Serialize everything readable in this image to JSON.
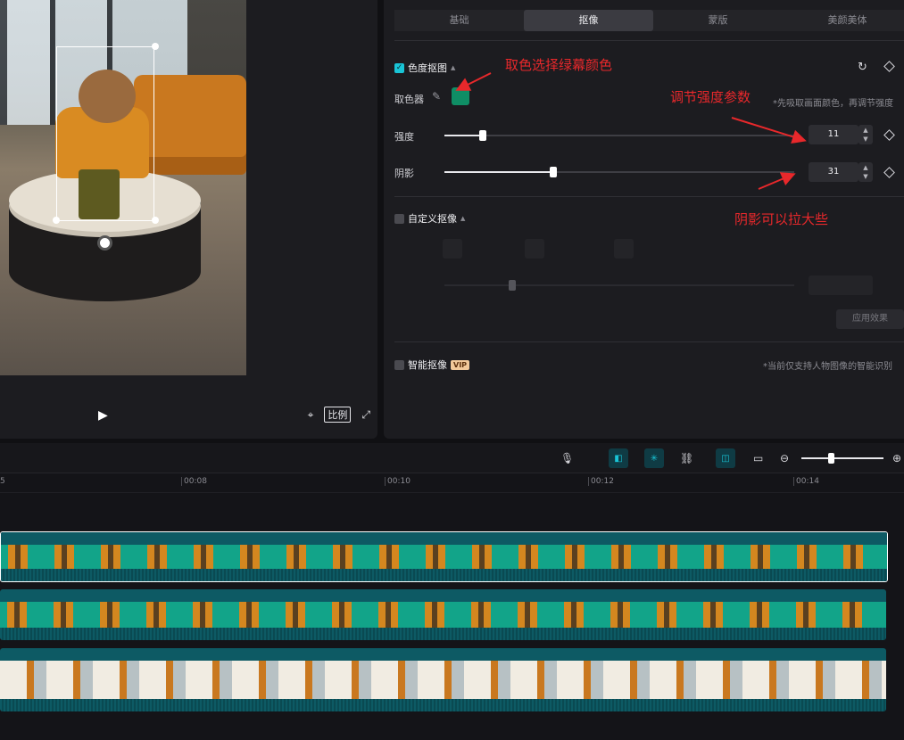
{
  "colors": {
    "accent": "#19c4d6",
    "annotation": "#e8282b",
    "key_color": "#0f8e65"
  },
  "preview": {
    "ratio_label": "比例",
    "icons": {
      "play": "play-icon",
      "screenshot": "focus-icon",
      "fullscreen": "fullscreen-icon"
    }
  },
  "props": {
    "tabs": [
      {
        "label": "基础",
        "active": false
      },
      {
        "label": "抠像",
        "active": true
      },
      {
        "label": "蒙版",
        "active": false
      },
      {
        "label": "美颜美体",
        "active": false
      }
    ],
    "chroma": {
      "title": "色度抠图",
      "picker_label": "取色器",
      "hint": "*先吸取画面颜色，再调节强度",
      "strength": {
        "label": "强度",
        "value": "11",
        "fraction": 0.11
      },
      "shadow": {
        "label": "阴影",
        "value": "31",
        "fraction": 0.31
      }
    },
    "custom": {
      "title": "自定义抠像",
      "apply_label": "应用效果"
    },
    "smart": {
      "title": "智能抠像",
      "vip": "VIP",
      "hint": "*当前仅支持人物图像的智能识别"
    }
  },
  "annotations": {
    "pick_color": "取色选择绿幕颜色",
    "adjust_strength": "调节强度参数",
    "shadow_tip": "阴影可以拉大些"
  },
  "timeline": {
    "ticks": [
      "00:08",
      "00:10",
      "00:12",
      "00:14"
    ],
    "ruler_start_fragment": "5"
  }
}
